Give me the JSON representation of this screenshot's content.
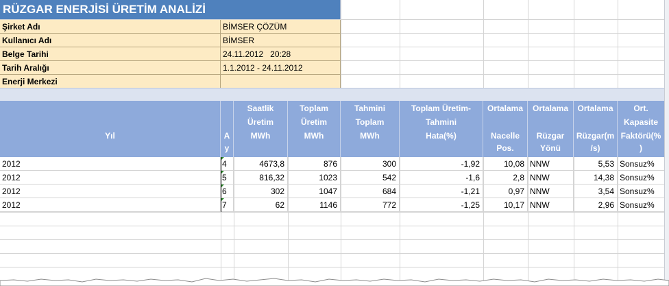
{
  "report": {
    "title": "RÜZGAR ENERJİSİ ÜRETİM ANALİZİ",
    "info": [
      {
        "label": "Şirket Adı",
        "value": "BİMSER ÇÖZÜM"
      },
      {
        "label": "Kullanıcı Adı",
        "value": "BİMSER"
      },
      {
        "label": "Belge Tarihi",
        "value": "24.11.2012   20:28"
      },
      {
        "label": "Tarih Aralığı",
        "value": "1.1.2012 - 24.11.2012"
      },
      {
        "label": "Enerji Merkezi",
        "value": ""
      }
    ]
  },
  "table": {
    "headers": {
      "yil": "Yıl",
      "ay_1": "A",
      "ay_2": "y",
      "saatlik_1": "Saatlik",
      "saatlik_2": "Üretim",
      "saatlik_3": "MWh",
      "toplam_1": "Toplam",
      "toplam_2": "Üretim",
      "toplam_3": "MWh",
      "tahmini_1": "Tahmini",
      "tahmini_2": "Toplam",
      "tahmini_3": "MWh",
      "hata_1": "Toplam Üretim-",
      "hata_2": "Tahmini",
      "hata_3": "Hata(%)",
      "nacelle_1": "Ortalama",
      "nacelle_2": "Nacelle",
      "nacelle_3": "Pos.",
      "yonu_1": "Ortalama",
      "yonu_2": "Rüzgar",
      "yonu_3": "Yönü",
      "hiz_1": "Ortalama",
      "hiz_2": "Rüzgar(m",
      "hiz_3": "/s)",
      "kapasite_1": "Ort.",
      "kapasite_2": "Kapasite",
      "kapasite_3": "Faktörü(%",
      "kapasite_4": ")"
    },
    "rows": [
      {
        "yil": "2012",
        "ay": "4",
        "saatlik": "4673,8",
        "toplam": "876",
        "tahmini": "300",
        "hata": "-1,92",
        "nacelle": "10,08",
        "yonu": "NNW",
        "hiz": "5,53",
        "kapasite": "Sonsuz%"
      },
      {
        "yil": "2012",
        "ay": "5",
        "saatlik": "816,32",
        "toplam": "1023",
        "tahmini": "542",
        "hata": "-1,6",
        "nacelle": "2,8",
        "yonu": "NNW",
        "hiz": "14,38",
        "kapasite": "Sonsuz%"
      },
      {
        "yil": "2012",
        "ay": "6",
        "saatlik": "302",
        "toplam": "1047",
        "tahmini": "684",
        "hata": "-1,21",
        "nacelle": "0,97",
        "yonu": "NNW",
        "hiz": "3,54",
        "kapasite": "Sonsuz%"
      },
      {
        "yil": "2012",
        "ay": "7",
        "saatlik": "62",
        "toplam": "1146",
        "tahmini": "772",
        "hata": "-1,25",
        "nacelle": "10,17",
        "yonu": "NNW",
        "hiz": "2,96",
        "kapasite": "Sonsuz%"
      }
    ]
  },
  "colors": {
    "title_bg": "#4f81bd",
    "info_bg": "#fdebc4",
    "header_bg": "#8eaadb",
    "band_bg": "#dce3f0",
    "error_marker": "#2e8b2e"
  }
}
